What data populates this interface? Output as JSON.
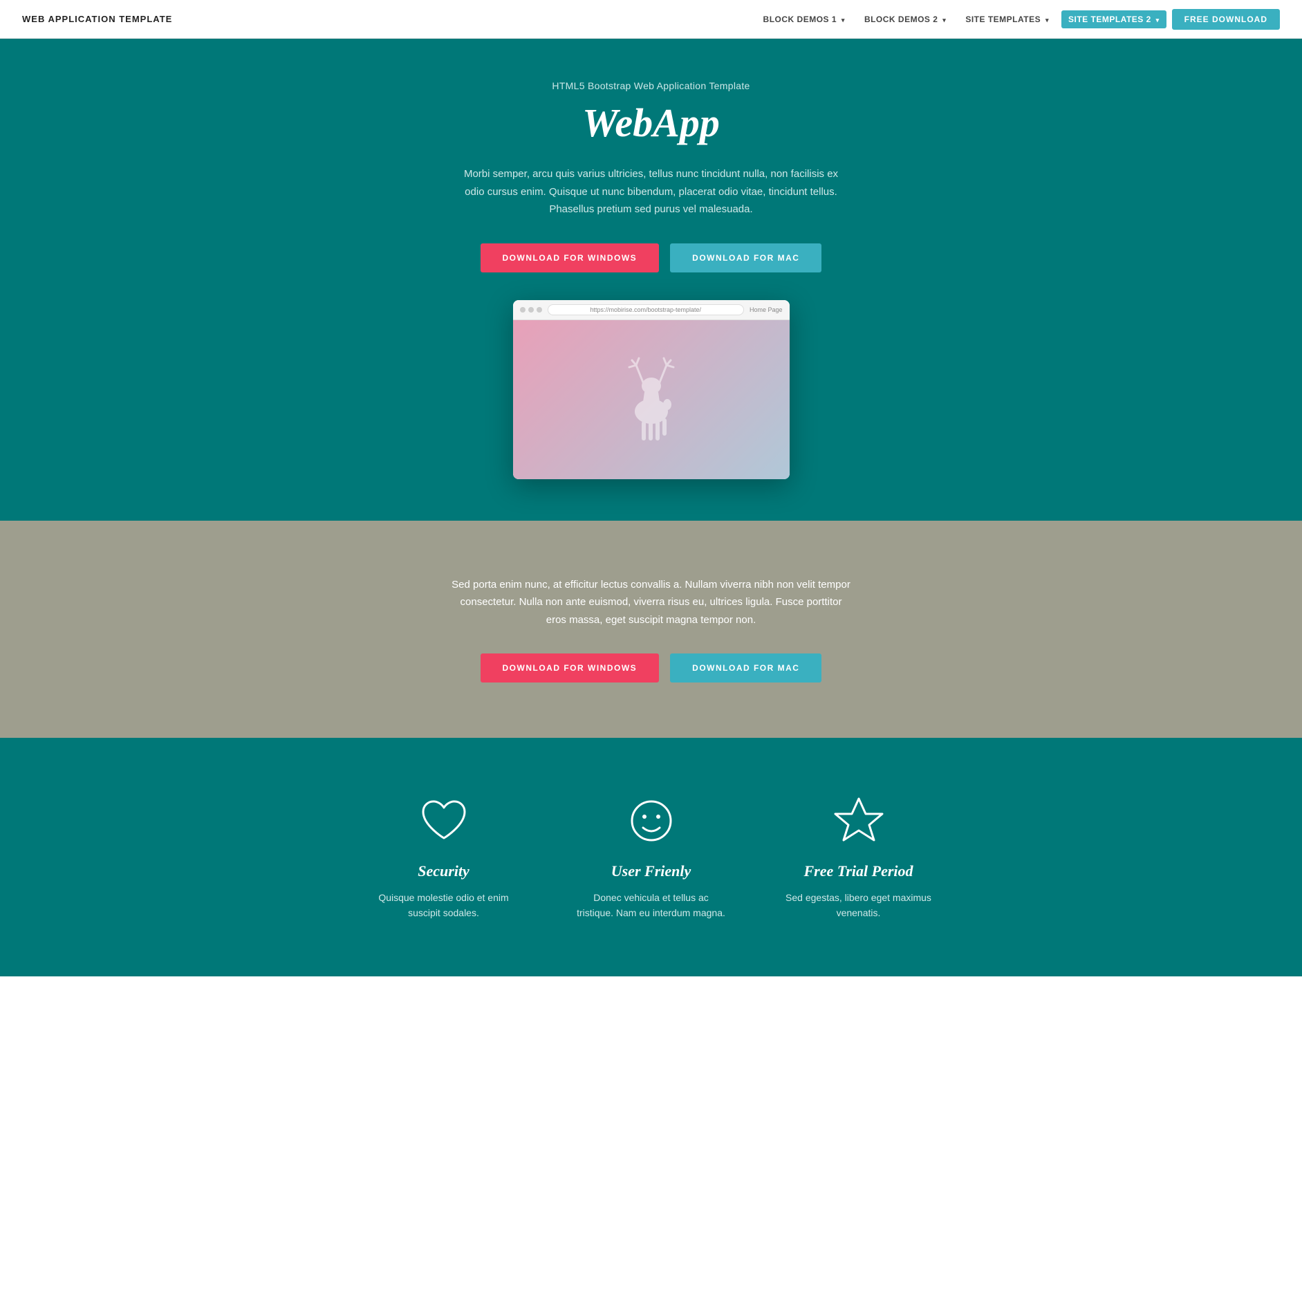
{
  "navbar": {
    "brand": "WEB APPLICATION TEMPLATE",
    "block_demos_1": "BLOCK DEMOS 1",
    "block_demos_2": "BLOCK DEMOS 2",
    "site_templates": "SITE TEMPLATES",
    "site_templates_2": "SITE TEMPLATES 2",
    "free_download": "FREE DOWNLOAD"
  },
  "hero": {
    "subtitle": "HTML5 Bootstrap Web Application Template",
    "title": "WebApp",
    "description": "Morbi semper, arcu quis varius ultricies, tellus nunc tincidunt nulla, non facilisis ex odio cursus enim. Quisque ut nunc bibendum, placerat odio vitae, tincidunt tellus. Phasellus pretium sed purus vel malesuada.",
    "btn_windows": "DOWNLOAD FOR WINDOWS",
    "btn_mac": "DOWNLOAD FOR MAC",
    "browser_url": "https://mobirise.com/bootstrap-template/",
    "browser_home": "Home Page"
  },
  "gray_section": {
    "description": "Sed porta enim nunc, at efficitur lectus convallis a. Nullam viverra nibh non velit tempor consectetur. Nulla non ante euismod, viverra risus eu, ultrices ligula. Fusce porttitor eros massa, eget suscipit magna tempor non.",
    "btn_windows": "DOWNLOAD FOR WINDOWS",
    "btn_mac": "DOWNLOAD FOR MAC"
  },
  "features": {
    "items": [
      {
        "icon": "heart",
        "title": "Security",
        "description": "Quisque molestie odio et enim suscipit sodales."
      },
      {
        "icon": "smiley",
        "title": "User Frienly",
        "description": "Donec vehicula et tellus ac tristique. Nam eu interdum magna."
      },
      {
        "icon": "star",
        "title": "Free Trial Period",
        "description": "Sed egestas, libero eget maximus venenatis."
      }
    ]
  }
}
